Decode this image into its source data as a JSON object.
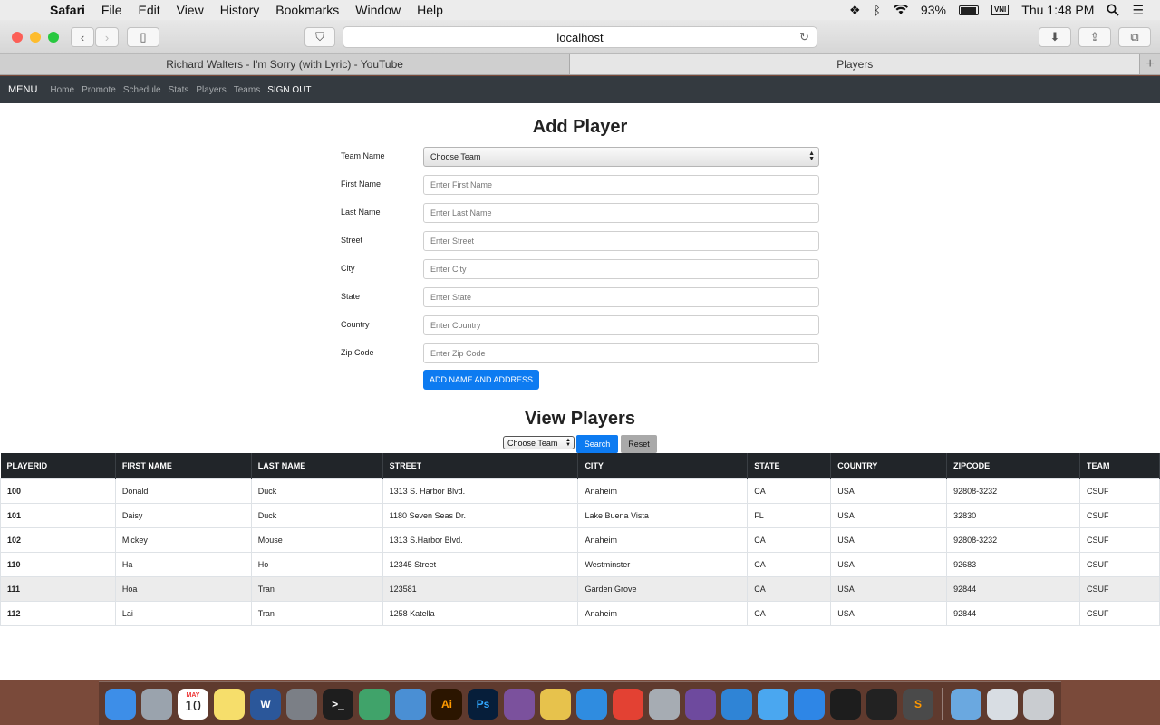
{
  "menubar": {
    "app": "Safari",
    "items": [
      "File",
      "Edit",
      "View",
      "History",
      "Bookmarks",
      "Window",
      "Help"
    ],
    "battery": "93%",
    "input_source": "VNI",
    "clock": "Thu 1:48 PM"
  },
  "browser": {
    "url": "localhost",
    "tabs": [
      {
        "label": "Richard Walters - I'm Sorry (with Lyric) - YouTube",
        "active": false
      },
      {
        "label": "Players",
        "active": true
      }
    ]
  },
  "navbar": {
    "brand": "MENU",
    "links": [
      "Home",
      "Promote",
      "Schedule",
      "Stats",
      "Players",
      "Teams"
    ],
    "signout": "SIGN OUT"
  },
  "add_player": {
    "title": "Add Player",
    "fields": [
      {
        "label": "Team Name",
        "value": "Choose Team",
        "type": "select"
      },
      {
        "label": "First Name",
        "placeholder": "Enter First Name"
      },
      {
        "label": "Last Name",
        "placeholder": "Enter Last Name"
      },
      {
        "label": "Street",
        "placeholder": "Enter Street"
      },
      {
        "label": "City",
        "placeholder": "Enter City"
      },
      {
        "label": "State",
        "placeholder": "Enter State"
      },
      {
        "label": "Country",
        "placeholder": "Enter Country"
      },
      {
        "label": "Zip Code",
        "placeholder": "Enter Zip Code"
      }
    ],
    "submit_label": "ADD NAME AND ADDRESS"
  },
  "view_players": {
    "title": "View Players",
    "filter_value": "Choose Team",
    "search_label": "Search",
    "reset_label": "Reset",
    "columns": [
      "PLAYERID",
      "FIRST NAME",
      "LAST NAME",
      "STREET",
      "CITY",
      "STATE",
      "COUNTRY",
      "ZIPCODE",
      "TEAM"
    ],
    "rows": [
      [
        "100",
        "Donald",
        "Duck",
        "1313 S. Harbor Blvd.",
        "Anaheim",
        "CA",
        "USA",
        "92808-3232",
        "CSUF"
      ],
      [
        "101",
        "Daisy",
        "Duck",
        "1180 Seven Seas Dr.",
        "Lake Buena Vista",
        "FL",
        "USA",
        "32830",
        "CSUF"
      ],
      [
        "102",
        "Mickey",
        "Mouse",
        "1313 S.Harbor Blvd.",
        "Anaheim",
        "CA",
        "USA",
        "92808-3232",
        "CSUF"
      ],
      [
        "110",
        "Ha",
        "Ho",
        "12345 Street",
        "Westminster",
        "CA",
        "USA",
        "92683",
        "CSUF"
      ],
      [
        "111",
        "Hoa",
        "Tran",
        "123581",
        "Garden Grove",
        "CA",
        "USA",
        "92844",
        "CSUF"
      ],
      [
        "112",
        "Lai",
        "Tran",
        "1258 Katella",
        "Anaheim",
        "CA",
        "USA",
        "92844",
        "CSUF"
      ]
    ],
    "highlighted_row": 4
  },
  "dock": {
    "calendar_month": "MAY",
    "calendar_day": "10",
    "apps": [
      {
        "name": "finder-icon",
        "color": "#3d8ee8",
        "glyph": ""
      },
      {
        "name": "launchpad-icon",
        "color": "#9aa3ad",
        "glyph": ""
      },
      {
        "name": "calendar-icon",
        "color": "#ffffff",
        "glyph": ""
      },
      {
        "name": "notes-icon",
        "color": "#f6de6b",
        "glyph": ""
      },
      {
        "name": "word-icon",
        "color": "#2b579a",
        "glyph": "W"
      },
      {
        "name": "system-preferences-icon",
        "color": "#7b7f86",
        "glyph": ""
      },
      {
        "name": "terminal-icon",
        "color": "#1e1e1e",
        "glyph": ">_"
      },
      {
        "name": "atom-icon",
        "color": "#40a36a",
        "glyph": ""
      },
      {
        "name": "time-machine-icon",
        "color": "#4a8fd4",
        "glyph": ""
      },
      {
        "name": "illustrator-icon",
        "color": "#2b1500",
        "glyph": "Ai"
      },
      {
        "name": "photoshop-icon",
        "color": "#061e3a",
        "glyph": "Ps"
      },
      {
        "name": "viber-icon",
        "color": "#7b519d",
        "glyph": ""
      },
      {
        "name": "cyberduck-icon",
        "color": "#e7c24c",
        "glyph": ""
      },
      {
        "name": "xcode-icon",
        "color": "#2f8ce0",
        "glyph": ""
      },
      {
        "name": "chrome-icon",
        "color": "#e34133",
        "glyph": ""
      },
      {
        "name": "utility-icon",
        "color": "#a6acb3",
        "glyph": ""
      },
      {
        "name": "github-icon",
        "color": "#6e4a9e",
        "glyph": ""
      },
      {
        "name": "sourcetree-icon",
        "color": "#2f84d6",
        "glyph": ""
      },
      {
        "name": "messages-icon",
        "color": "#4aa7f0",
        "glyph": ""
      },
      {
        "name": "safari-icon",
        "color": "#2e86e6",
        "glyph": ""
      },
      {
        "name": "final-cut-icon",
        "color": "#1d1d1d",
        "glyph": ""
      },
      {
        "name": "unity-icon",
        "color": "#222222",
        "glyph": ""
      },
      {
        "name": "sublime-icon",
        "color": "#4a4a4a",
        "glyph": "S"
      },
      {
        "name": "folder-icon",
        "color": "#6aa8e0",
        "glyph": ""
      },
      {
        "name": "documents-icon",
        "color": "#d8dde3",
        "glyph": ""
      },
      {
        "name": "trash-icon",
        "color": "#c9ccd0",
        "glyph": ""
      }
    ]
  }
}
